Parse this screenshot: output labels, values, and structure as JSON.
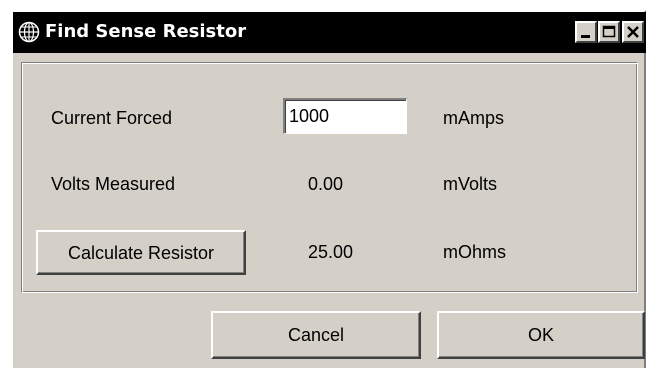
{
  "window": {
    "title": "Find Sense Resistor",
    "icon": "app-globe-icon",
    "controls": [
      "minimize-icon",
      "maximize-icon",
      "close-icon"
    ]
  },
  "form": {
    "current_forced": {
      "label": "Current Forced",
      "value": "1000",
      "unit": "mAmps"
    },
    "volts_measured": {
      "label": "Volts Measured",
      "value": "0.00",
      "unit": "mVolts"
    },
    "resistor": {
      "button_label": "Calculate Resistor",
      "value": "25.00",
      "unit": "mOhms"
    }
  },
  "buttons": {
    "cancel": "Cancel",
    "ok": "OK"
  },
  "colors": {
    "title_bar": "#000000",
    "title_text": "#ffffff",
    "face": "#d4d0c8"
  }
}
